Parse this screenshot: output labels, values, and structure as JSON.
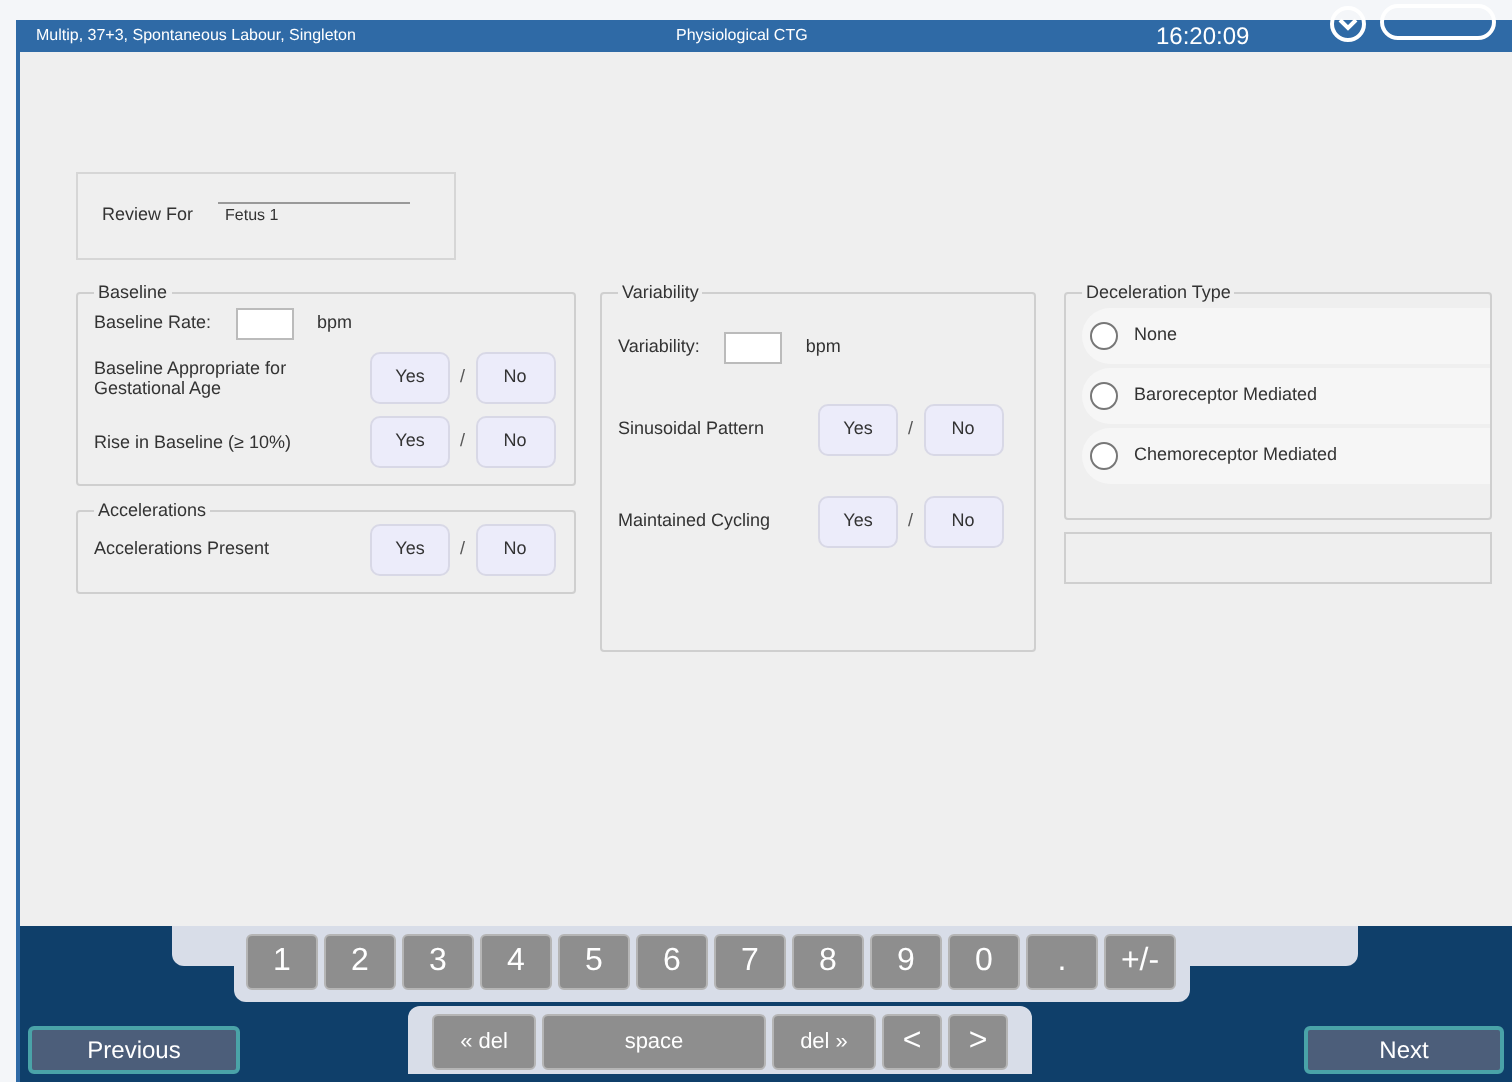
{
  "header": {
    "patient": "Multip, 37+3, Spontaneous Labour, Singleton",
    "title": "Physiological CTG",
    "time": "16:20:09"
  },
  "review": {
    "label": "Review For",
    "value": "Fetus 1"
  },
  "baseline": {
    "title": "Baseline",
    "rate_label": "Baseline Rate:",
    "unit": "bpm",
    "questions": [
      {
        "label": "Baseline Appropriate for Gestational Age",
        "options": [
          {
            "label": "Yes",
            "selected": false
          },
          {
            "label": "No",
            "selected": false
          }
        ],
        "separator": "/"
      },
      {
        "label": "Rise in Baseline (≥ 10%)",
        "options": [
          {
            "label": "Yes",
            "selected": false
          },
          {
            "label": "No",
            "selected": false
          }
        ],
        "separator": "/"
      }
    ]
  },
  "accelerations": {
    "title": "Accelerations",
    "questions": [
      {
        "label": "Accelerations Present",
        "options": [
          {
            "label": "Yes",
            "selected": false
          },
          {
            "label": "No",
            "selected": false
          }
        ],
        "separator": "/"
      }
    ]
  },
  "variability": {
    "title": "Variability",
    "rate_label": "Variability:",
    "unit": "bpm",
    "questions": [
      {
        "label": "Sinusoidal Pattern",
        "options": [
          {
            "label": "Yes",
            "selected": false
          },
          {
            "label": "No",
            "selected": false
          }
        ],
        "separator": "/"
      },
      {
        "label": "Maintained Cycling",
        "options": [
          {
            "label": "Yes",
            "selected": false
          },
          {
            "label": "No",
            "selected": false
          }
        ],
        "separator": "/"
      }
    ]
  },
  "deceleration": {
    "title": "Deceleration Type",
    "options": [
      {
        "label": "None",
        "selected": false
      },
      {
        "label": "Baroreceptor Mediated",
        "selected": false
      },
      {
        "label": "Chemoreceptor Mediated",
        "selected": false
      }
    ]
  },
  "keyboard": {
    "disabled": true,
    "row_1": [
      "1",
      "2",
      "3",
      "4",
      "5",
      "6",
      "7",
      "8",
      "9",
      "0",
      ".",
      "+/-"
    ],
    "row_2": [
      "« del",
      "space",
      "del »",
      "<",
      ">"
    ]
  },
  "nav": {
    "previous": "Previous",
    "next": "Next"
  }
}
